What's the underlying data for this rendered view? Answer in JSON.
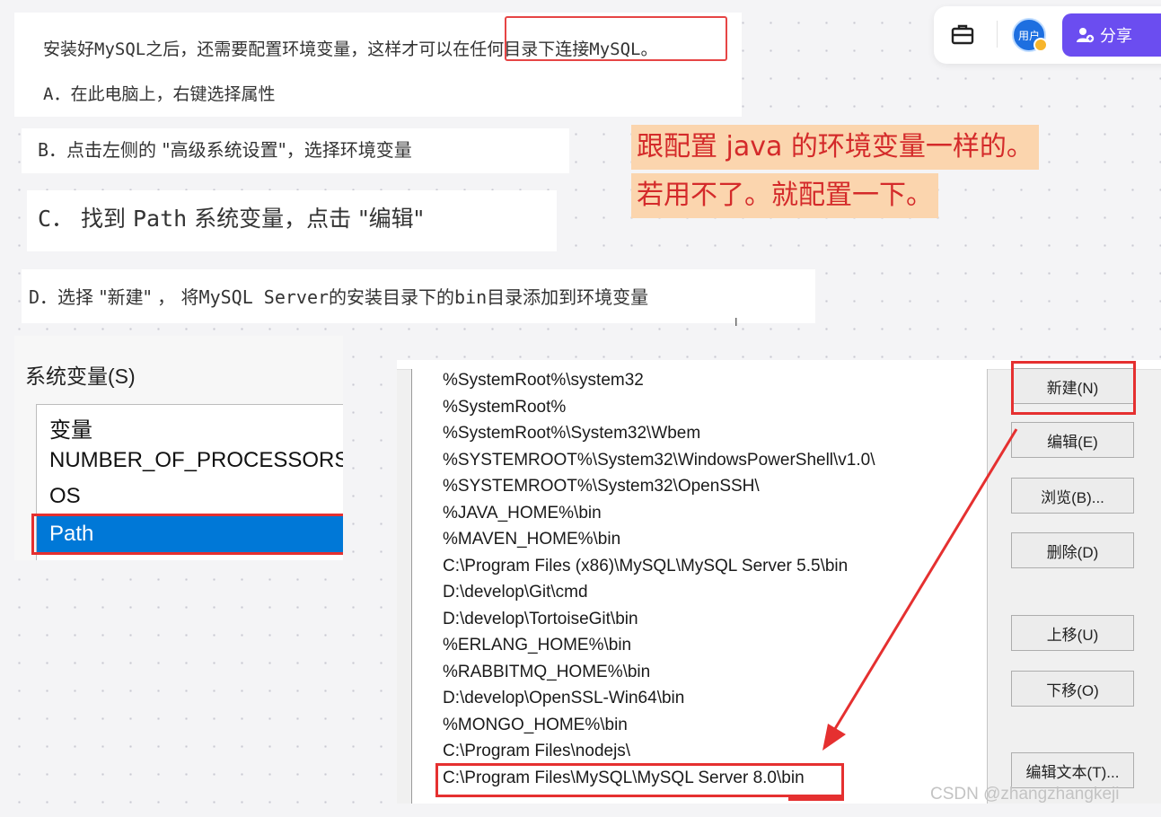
{
  "instructions": {
    "intro_before": "安装好",
    "intro_mono1": "MySQL",
    "intro_mid": "之后，还需要配置环境变量，这样才可以",
    "intro_highlight": "在任何目录下连接",
    "intro_mono2": "MySQL",
    "intro_end": "。",
    "step_a_letter": "A．",
    "step_a_text": "在此电脑上，右键选择属性",
    "step_b_letter": "B．",
    "step_b_text": "点击左侧的 \"高级系统设置\"，选择环境变量",
    "step_c_letter": "C．",
    "step_c_text1": "找到",
    "step_c_mono": "Path",
    "step_c_text2": "系统变量，点击 \"编辑\"",
    "step_d_letter": "D．",
    "step_d_text1": "选择 \"新建\" ， 将",
    "step_d_mono1": "MySQL Server",
    "step_d_text2": "的安装目录下的",
    "step_d_mono2": "bin",
    "step_d_text3": "目录添加到环境变量"
  },
  "note": {
    "line1": "跟配置 java 的环境变量一样的。",
    "line2": "若用不了。就配置一下。"
  },
  "toolbar": {
    "toolbox_icon": "briefcase-icon",
    "avatar_label": "用户",
    "share_label": "分享",
    "share_icon": "add-user-icon"
  },
  "system_variables": {
    "title": "系统变量(S)",
    "column_header": "变量",
    "rows": [
      "NUMBER_OF_PROCESSORS",
      "OS",
      "Path"
    ],
    "selected": "Path"
  },
  "path_editor": {
    "entries": [
      "%SystemRoot%\\system32",
      "%SystemRoot%",
      "%SystemRoot%\\System32\\Wbem",
      "%SYSTEMROOT%\\System32\\WindowsPowerShell\\v1.0\\",
      "%SYSTEMROOT%\\System32\\OpenSSH\\",
      "%JAVA_HOME%\\bin",
      "%MAVEN_HOME%\\bin",
      "C:\\Program Files (x86)\\MySQL\\MySQL Server 5.5\\bin",
      "D:\\develop\\Git\\cmd",
      "D:\\develop\\TortoiseGit\\bin",
      "%ERLANG_HOME%\\bin",
      "%RABBITMQ_HOME%\\bin",
      "D:\\develop\\OpenSSL-Win64\\bin",
      "%MONGO_HOME%\\bin",
      "C:\\Program Files\\nodejs\\",
      "C:\\Program Files\\MySQL\\MySQL Server 8.0\\bin"
    ],
    "buttons": {
      "new": "新建(N)",
      "edit": "编辑(E)",
      "browse": "浏览(B)...",
      "delete": "删除(D)",
      "move_up": "上移(U)",
      "move_down": "下移(O)",
      "edit_text": "编辑文本(T)..."
    }
  },
  "colors": {
    "highlight_red": "#e53030",
    "note_background": "#fbd5ae",
    "note_text": "#d42a2a",
    "share_button": "#6b4df0",
    "selection_blue": "#0078d7"
  },
  "watermark": "CSDN @zhangzhangkeji"
}
